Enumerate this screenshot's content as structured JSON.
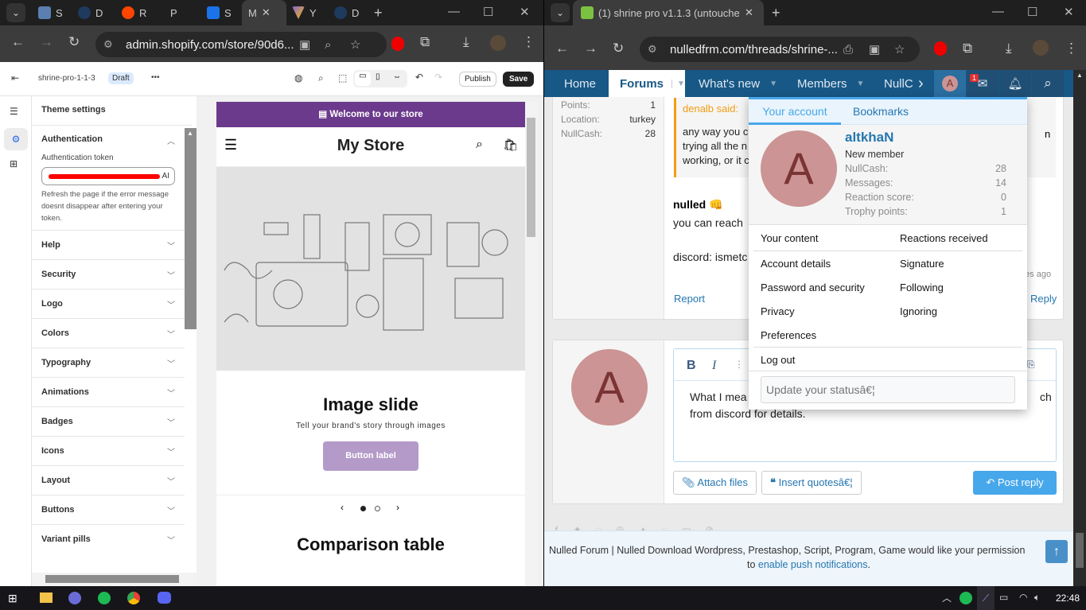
{
  "left_browser": {
    "tabs": [
      "S",
      "D",
      "R",
      "P",
      "S",
      "M",
      "Y",
      "D"
    ],
    "tab_colors": [
      "#5b7fb0",
      "#1e3a5f",
      "#ff4500",
      "#aaaaaa",
      "#1a73e8",
      "#cccccc",
      "#8a63d2",
      "#1e3a5f"
    ],
    "url": "admin.shopify.com/store/90d6..."
  },
  "shopify": {
    "theme_name": "shrine-pro-1-1-3",
    "status_badge": "Draft",
    "more": "•••",
    "publish": "Publish",
    "save": "Save",
    "sidebar_title": "Theme settings",
    "auth_section": "Authentication",
    "auth_label": "Authentication token",
    "auth_value_tail": "AI",
    "auth_help": "Refresh the page if the error message doesnt disappear after entering your token.",
    "sections": [
      "Help",
      "Security",
      "Logo",
      "Colors",
      "Typography",
      "Animations",
      "Badges",
      "Icons",
      "Layout",
      "Buttons",
      "Variant pills"
    ],
    "preview": {
      "banner": "Welcome to our store",
      "store_name": "My Store",
      "slide_title": "Image slide",
      "slide_sub": "Tell your brand's story through images",
      "button": "Button label",
      "next_section": "Comparison table",
      "banner_color": "#6b3a8c",
      "button_color": "#b49ac8"
    }
  },
  "right_browser": {
    "tab_title": "(1) shrine pro v1.1.3 (untouched",
    "url": "nulledfrm.com/threads/shrine-..."
  },
  "forum": {
    "nav": [
      "Home",
      "Forums",
      "What's new",
      "Members",
      "NullC"
    ],
    "badge": "1",
    "user_stats": [
      {
        "k": "Points:",
        "v": "1"
      },
      {
        "k": "Location:",
        "v": "turkey"
      },
      {
        "k": "NullCash:",
        "v": "28"
      }
    ],
    "quote_author": "denalb said:",
    "quote_lines": [
      "any way you co",
      "trying all the n",
      "working, or it c"
    ],
    "quote_tail": "n",
    "post_title": "nulled 👊",
    "post_line1": "you can reach",
    "post_line2": "discord: ismetc",
    "time_tail": "tes ago",
    "report": "Report",
    "reply": "Reply",
    "editor_text_1": "What I mea",
    "editor_text_1_tail": "ch",
    "editor_text_2": "from discord for details.",
    "attach": "Attach files",
    "insert_quotes": "Insert quotesâ€¦",
    "post_reply": "Post reply",
    "push_text": "Nulled Forum | Nulled Download Wordpress, Prestashop, Script, Program, Game would like your permission",
    "push_to": "to",
    "push_link": "enable push notifications",
    "push_end": "."
  },
  "account_menu": {
    "tabs": [
      "Your account",
      "Bookmarks"
    ],
    "avatar_letter": "A",
    "username": "altkhaN",
    "role": "New member",
    "stats": [
      {
        "k": "NullCash:",
        "v": "28"
      },
      {
        "k": "Messages:",
        "v": "14"
      },
      {
        "k": "Reaction score:",
        "v": "0"
      },
      {
        "k": "Trophy points:",
        "v": "1"
      }
    ],
    "links_left": [
      "Your content",
      "Account details",
      "Password and security",
      "Privacy",
      "Preferences"
    ],
    "links_right": [
      "Reactions received",
      "Signature",
      "Following",
      "Ignoring"
    ],
    "logout": "Log out",
    "status_placeholder": "Update your statusâ€¦"
  },
  "taskbar": {
    "time": "22:48"
  }
}
